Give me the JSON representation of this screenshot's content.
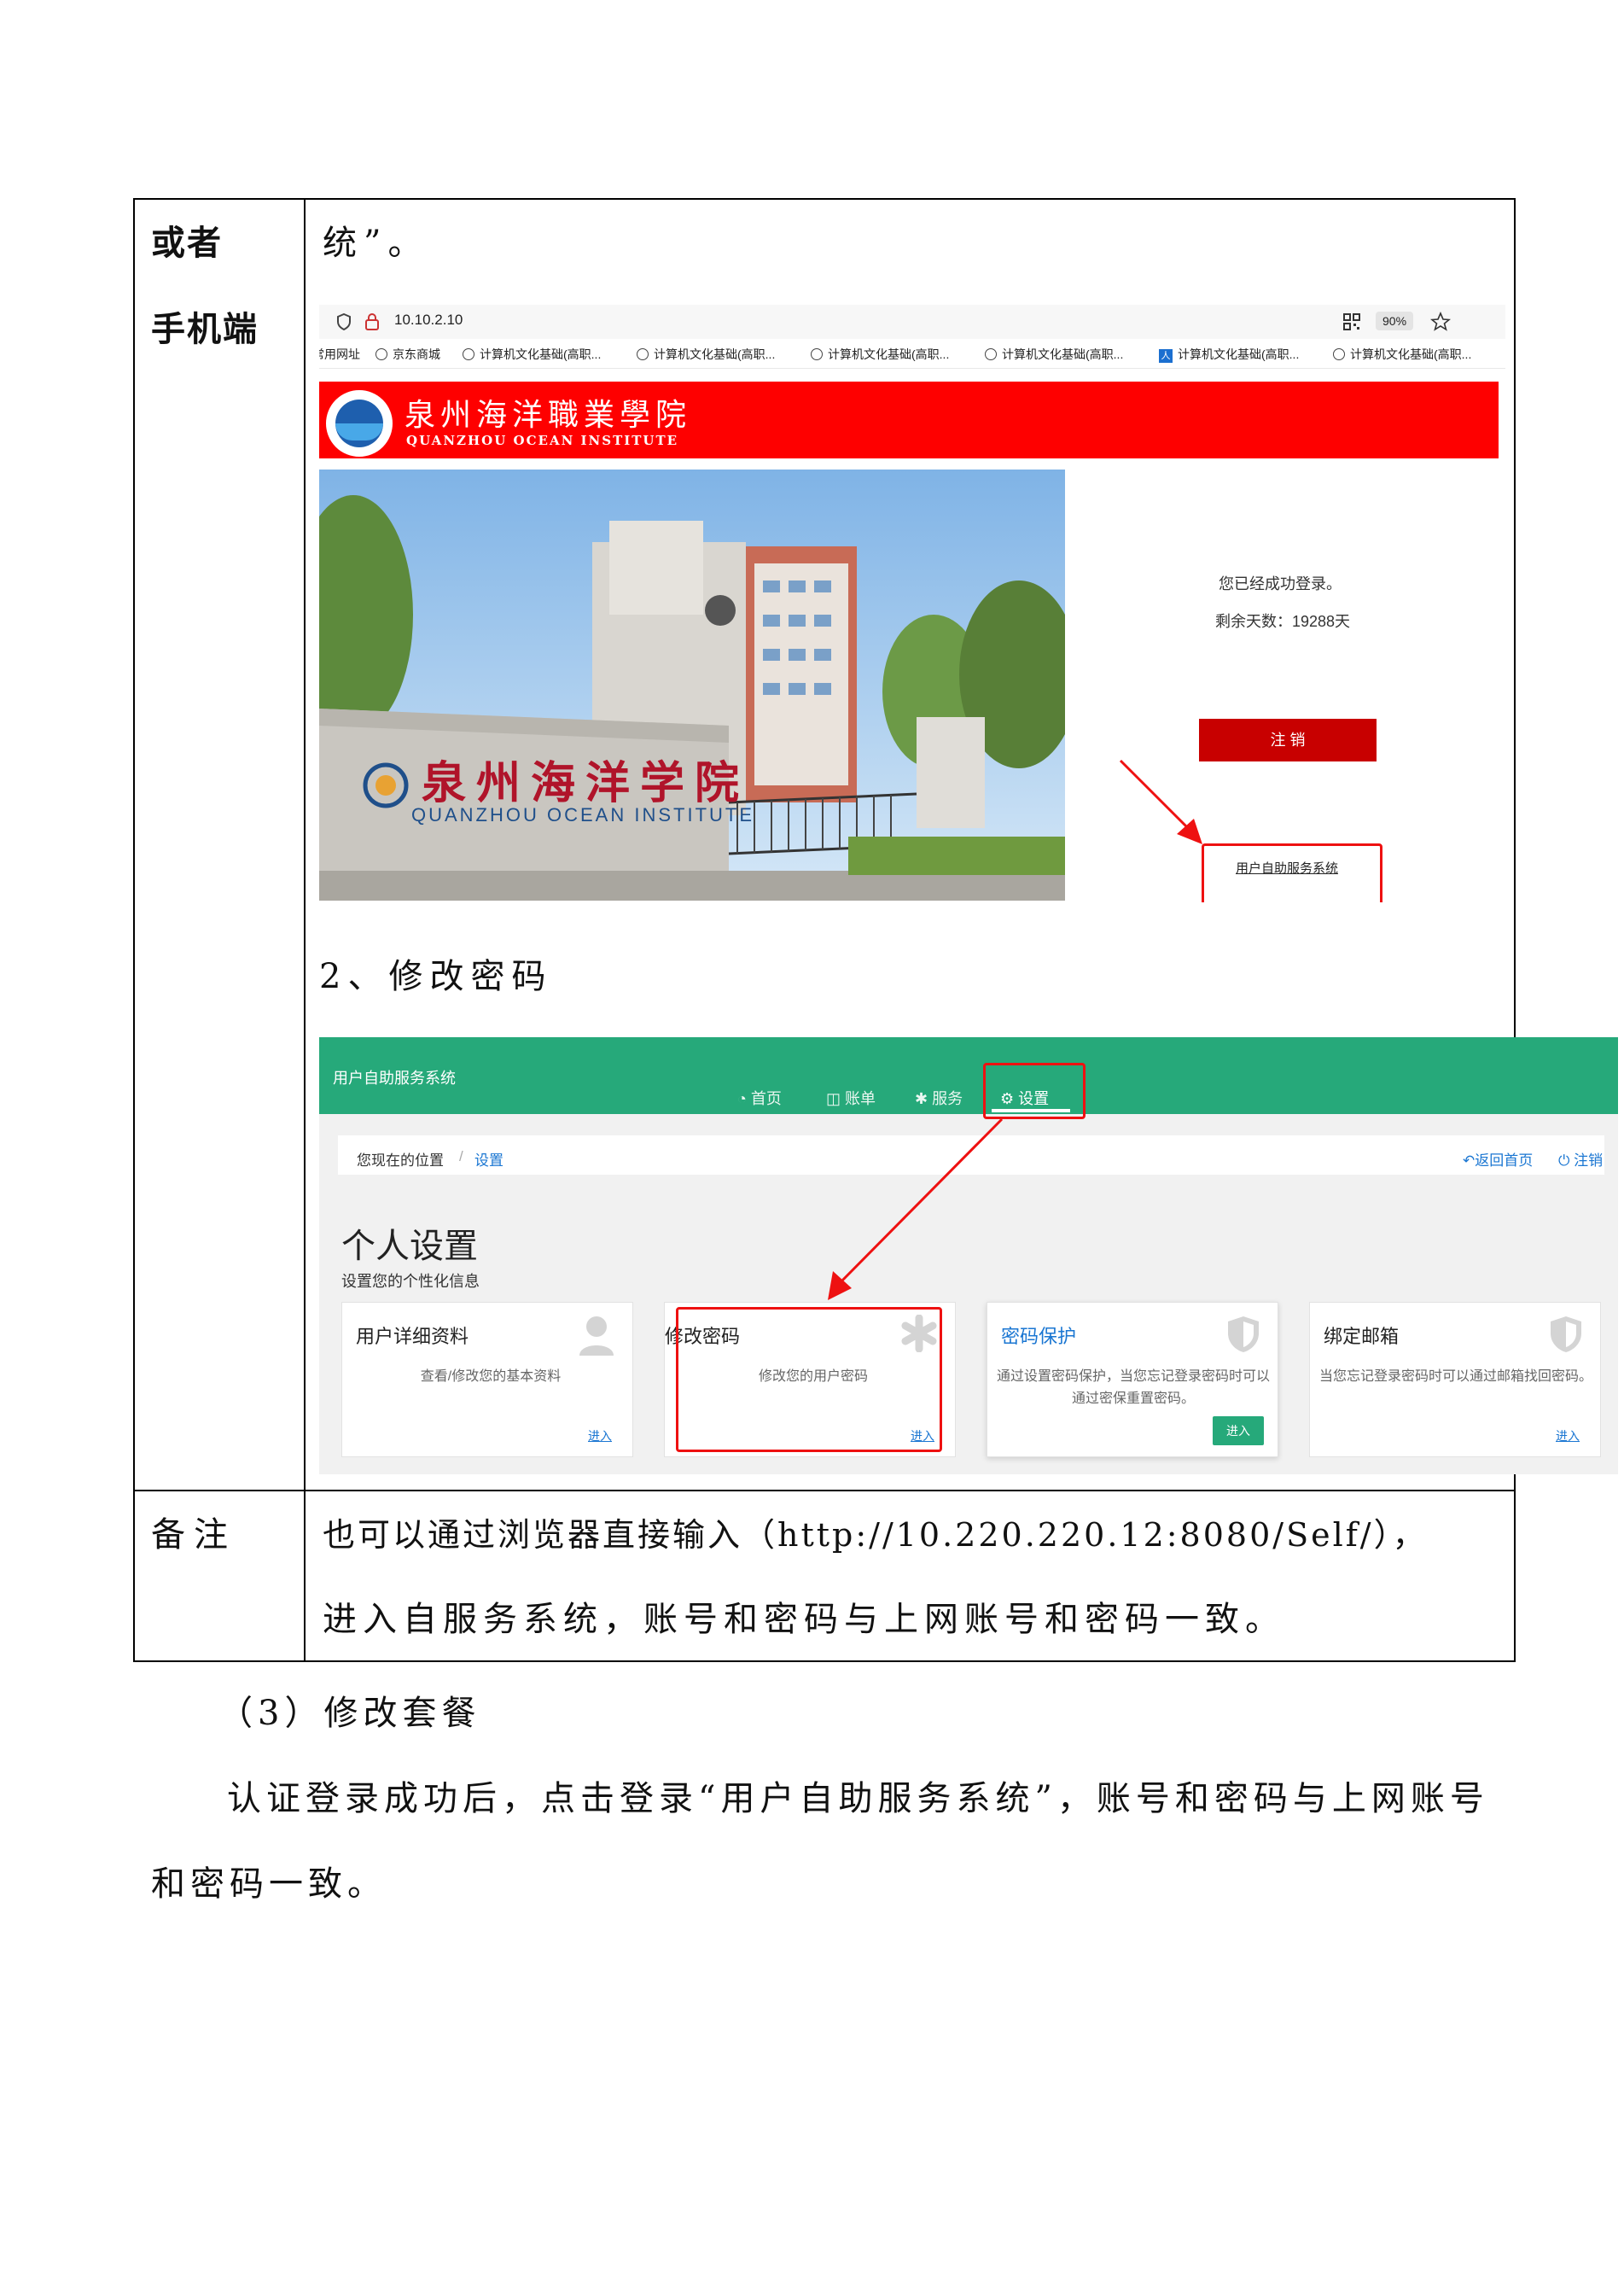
{
  "table": {
    "row1_label_line1": "或者",
    "row1_label_line2": "手机端",
    "row1_text": "统”。",
    "step2_title": "2、修改密码",
    "row2_label": "备注",
    "row2_line1": "也可以通过浏览器直接输入（http://10.220.220.12:8080/Self/），",
    "row2_line2": "进入自服务系统，账号和密码与上网账号和密码一致。"
  },
  "browser": {
    "url": "10.10.2.10",
    "zoom": "90%",
    "bookmarks": [
      "常用网址",
      "京东商城",
      "计算机文化基础(高职...",
      "计算机文化基础(高职...",
      "计算机文化基础(高职...",
      "计算机文化基础(高职...",
      "计算机文化基础(高职...",
      "计算机文化基础(高职..."
    ]
  },
  "portal": {
    "school_cn": "泉州海洋職業學院",
    "school_en": "QUANZHOU OCEAN INSTITUTE",
    "gate_cn": "泉州海洋学院",
    "gate_en": "QUANZHOU OCEAN INSTITUTE",
    "login_ok": "您已经成功登录。",
    "days_left": "剩余天数：19288天",
    "logout_label": "注 销",
    "self_service_link": "用户自助服务系统"
  },
  "self_service": {
    "title": "用户自助服务系统",
    "nav": [
      "首页",
      "账单",
      "服务",
      "设置"
    ],
    "breadcrumb_prefix": "您现在的位置",
    "breadcrumb_sep": "/",
    "breadcrumb_current": "设置",
    "return_home": "返回首页",
    "logout": "注销",
    "heading": "个人设置",
    "subheading": "设置您的个性化信息",
    "cards": [
      {
        "title": "用户详细资料",
        "desc": "查看/修改您的基本资料",
        "enter": "进入"
      },
      {
        "title": "修改密码",
        "desc": "修改您的用户密码",
        "enter": "进入"
      },
      {
        "title": "密码保护",
        "desc": "通过设置密码保护，当您忘记登录密码时可以通过密保重置密码。",
        "enter": "进入"
      },
      {
        "title": "绑定邮箱",
        "desc": "当您忘记登录密码时可以通过邮箱找回密码。",
        "enter": "进入"
      }
    ]
  },
  "section3_title": "（3）修改套餐",
  "para_line1": "认证登录成功后，点击登录“用户自助服务系统”，账号和密码与上网账号",
  "para_line2": "和密码一致。",
  "colors": {
    "portal_red": "#fe0000",
    "logout_red": "#c80000",
    "highlight_red": "#ee1111",
    "header_green": "#26a97a",
    "link_blue": "#1a76d2"
  }
}
